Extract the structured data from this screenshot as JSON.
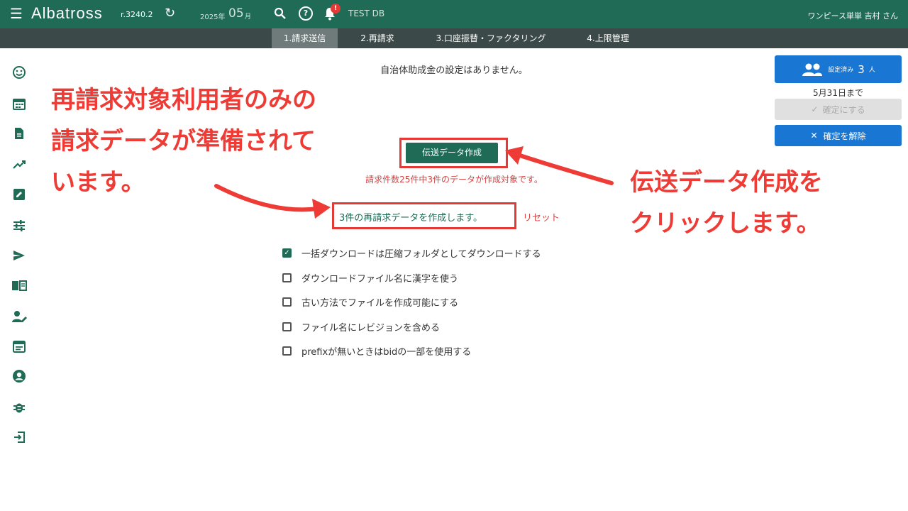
{
  "header": {
    "brand": "Albatross",
    "version": "r.3240.2",
    "year_label": "2025年",
    "month": "05",
    "month_suffix": "月",
    "notification_count": "!",
    "db_label": "TEST DB",
    "user_label": "ワンピース単単 吉村 さん",
    "icons": [
      "menu-icon",
      "refresh-icon",
      "search-icon",
      "help-icon",
      "bell-icon"
    ]
  },
  "tabs": [
    {
      "label": "1.請求送信",
      "active": true
    },
    {
      "label": "2.再請求",
      "active": false
    },
    {
      "label": "3.口座振替・ファクタリング",
      "active": false
    },
    {
      "label": "4.上限管理",
      "active": false
    }
  ],
  "sidebar": {
    "icons": [
      "smile-icon",
      "calendar-icon",
      "document-icon",
      "trend-icon",
      "edit-icon",
      "tune-icon",
      "send-icon",
      "book-icon",
      "user-edit-icon",
      "event-icon",
      "account-circle-icon",
      "bug-icon",
      "exit-icon"
    ]
  },
  "main": {
    "notice": "自治体助成金の設定はありません。",
    "create_button": "伝送データ作成",
    "info_red": "請求件数25件中3件のデータが作成対象です。",
    "info_create": "3件の再請求データを作成します。",
    "reset_link": "リセット",
    "options": [
      {
        "label": "一括ダウンロードは圧縮フォルダとしてダウンロードする",
        "checked": true
      },
      {
        "label": "ダウンロードファイル名に漢字を使う",
        "checked": false
      },
      {
        "label": "古い方法でファイルを作成可能にする",
        "checked": false
      },
      {
        "label": "ファイル名にレビジョンを含める",
        "checked": false
      },
      {
        "label": "prefixが無いときはbidの一部を使用する",
        "checked": false
      }
    ]
  },
  "right_panel": {
    "set_label": "設定済み",
    "set_count": "3",
    "set_unit": "人",
    "deadline": "5月31日まで",
    "confirm_label": "確定にする",
    "cancel_label": "確定を解除"
  },
  "annotations": {
    "left": [
      "再請求対象利用者のみの",
      "請求データが準備されて",
      "います。"
    ],
    "right": [
      "伝送データ作成を",
      "クリックします。"
    ],
    "color": "#ee3b35"
  },
  "colors": {
    "primary": "#1f6b56",
    "tab_bar": "#3b4a48",
    "blue_button": "#1976d2",
    "red_text": "#d84343"
  }
}
